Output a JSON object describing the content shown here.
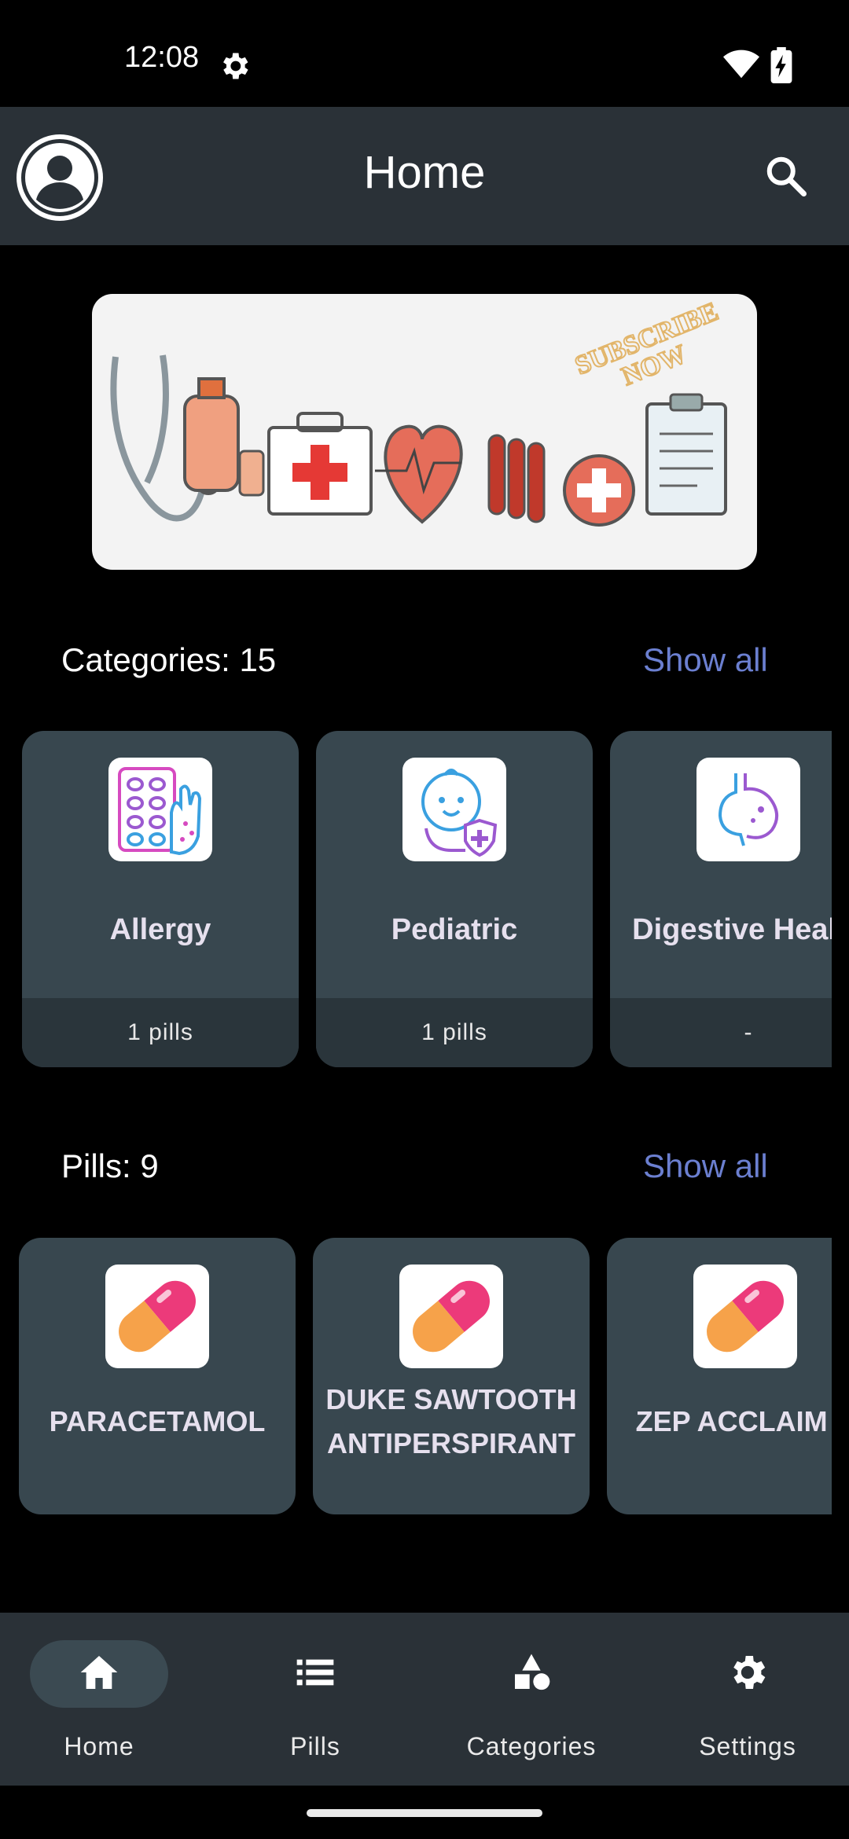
{
  "status": {
    "time": "12:08"
  },
  "header": {
    "title": "Home"
  },
  "banner": {
    "text_line1": "SUBSCRIBE",
    "text_line2": "NOW"
  },
  "categories": {
    "title": "Categories: 15",
    "show_all": "Show all",
    "items": [
      {
        "name": "Allergy",
        "count": "1 pills",
        "icon": "allergy-icon"
      },
      {
        "name": "Pediatric",
        "count": "1 pills",
        "icon": "pediatric-icon"
      },
      {
        "name": "Digestive Health",
        "count": "-",
        "icon": "digestive-icon"
      }
    ]
  },
  "pills": {
    "title": "Pills: 9",
    "show_all": "Show all",
    "items": [
      {
        "line1": "PARACETAMOL",
        "line2": "",
        "icon": "capsule-icon"
      },
      {
        "line1": "DUKE SAWTOOTH",
        "line2": "ANTIPERSPIRANT",
        "icon": "capsule-icon"
      },
      {
        "line1": "ZEP ACCLAIM A",
        "line2": "",
        "icon": "capsule-icon"
      }
    ]
  },
  "nav": {
    "items": [
      {
        "label": "Home",
        "icon": "home-icon",
        "active": true
      },
      {
        "label": "Pills",
        "icon": "list-icon",
        "active": false
      },
      {
        "label": "Categories",
        "icon": "shapes-icon",
        "active": false
      },
      {
        "label": "Settings",
        "icon": "gear-icon",
        "active": false
      }
    ]
  },
  "colors": {
    "accent": "#6b7fd0",
    "card": "#38474f",
    "bar": "#2a3137"
  }
}
